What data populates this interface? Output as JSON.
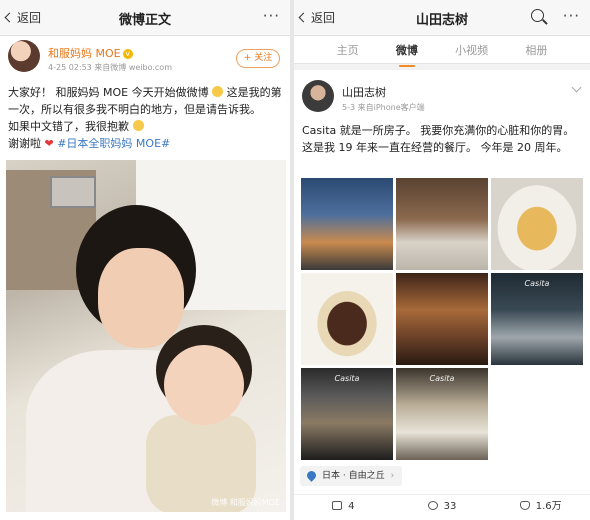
{
  "left": {
    "nav": {
      "back_label": "返回",
      "title": "微博正文",
      "more": "···"
    },
    "post": {
      "author": "和服妈妈 MOE",
      "meta": "4-25 02:53  来自微博 weibo.com",
      "follow_label": "+ 关注",
      "text_line1": "大家好！ 和服妈妈 MOE 今天开始做微博",
      "text_line1b": " 这是我的第",
      "text_line2": "一次，所以有很多我不明白的地方，但是请告诉我。",
      "text_line3": "如果中文错了，我很抱歉",
      "text_line4": "谢谢啦",
      "hashtag": "#日本全职妈妈 MOE#",
      "watermark": "微博 和服妈妈MOE"
    }
  },
  "right": {
    "nav": {
      "back_label": "返回",
      "title": "山田志树",
      "more": "···"
    },
    "tabs": [
      {
        "label": "主页",
        "active": false
      },
      {
        "label": "微博",
        "active": true
      },
      {
        "label": "小视频",
        "active": false
      },
      {
        "label": "相册",
        "active": false
      }
    ],
    "post": {
      "author": "山田志树",
      "meta": "5-3  来自iPhone客户端",
      "text": "Casita 就是一所房子。 我要你充满你的心脏和你的胃。 这是我 19 年来一直在经营的餐厅。 今年是 20 周年。",
      "photos": [
        {
          "label": ""
        },
        {
          "label": ""
        },
        {
          "label": ""
        },
        {
          "label": ""
        },
        {
          "label": ""
        },
        {
          "label": "Casita"
        },
        {
          "label": "Casita"
        },
        {
          "label": "Casita"
        }
      ],
      "location": "日本 · 自由之丘",
      "repost_count": "4",
      "comment_count": "33",
      "like_label": "1.6万"
    }
  },
  "colors": {
    "accent": "#f08a24",
    "link": "#3a78c2",
    "name_orange": "#e8771b"
  }
}
